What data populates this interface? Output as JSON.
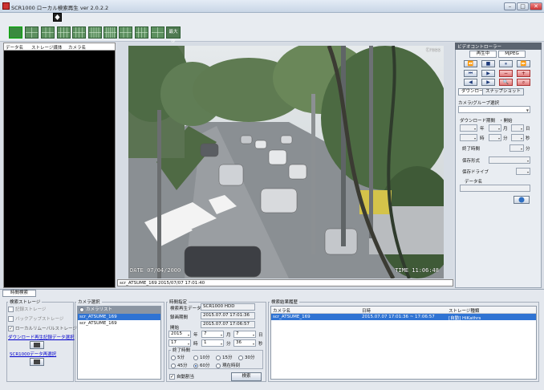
{
  "window": {
    "title": "SCR1000 ローカル検索再生  ver 2.0.2.2"
  },
  "left_list": {
    "headers": [
      "データ名",
      "ストレージ媒体",
      "カメラ名"
    ]
  },
  "video": {
    "caption_name": "scr_ATSUME_169",
    "caption_time": "2015/07/07 17:01:40",
    "osd_brand": "Cross",
    "osd_date": "DATE 07/04/2000",
    "osd_time": "TIME 11:06:48"
  },
  "video_controller": {
    "title": "ビデオコントローラー",
    "mode_tabs": [
      "再生中",
      "MJPEG"
    ],
    "tabs": [
      "ダウンロード",
      "スナップショット"
    ],
    "camera_group_label": "カメラ/グループ選択",
    "download_period_label": "ダウンロード期間",
    "start_label": "・開始",
    "year_unit": "年",
    "month_unit": "月",
    "day_unit": "日",
    "hour_unit": "時",
    "minute_unit": "分",
    "second_unit": "秒",
    "end_time_label": "終了時間",
    "end_minute_unit": "分",
    "save_format_label": "保存形式",
    "save_drive_label": "保存ドライブ",
    "data_name_label": "データ名"
  },
  "bottom_tab": "時間検索",
  "search_storage": {
    "title": "検索ストレージ",
    "options": [
      "記録ストレージ",
      "バックアップストレージ",
      "ローカルリムーバルストレージ"
    ],
    "download_link": "ダウンロード再生記録データ選択",
    "scr_link": "SCR1000データ再選択"
  },
  "camera_select": {
    "title": "カメラ選択",
    "items": [
      "カメラリスト",
      "scr_ATSUME_169",
      "scr_ATSUME_169"
    ]
  },
  "time_spec": {
    "title": "時間指定",
    "search_data_label": "検索再生データ",
    "search_data_value": "SCR1000 HDD",
    "recording_period_label": "録画期間",
    "recording_start": "2015.07.07 17:01:36",
    "recording_end": "2015.07.07 17:06:57",
    "start_label": "開始",
    "year": "2015",
    "year_unit": "年",
    "month": "7",
    "month_unit": "月",
    "day": "7",
    "day_unit": "日",
    "hour": "17",
    "hour_unit": "時",
    "minute": "1",
    "minute_unit": "分",
    "second": "36",
    "second_unit": "秒",
    "end_time_label": "終了時間",
    "durations": [
      "5分",
      "10分",
      "15分",
      "30分",
      "45分",
      "60分",
      "現在時刻"
    ],
    "selected_duration": "60分",
    "auto_split_label": "自動割当",
    "search_button": "検索"
  },
  "results": {
    "title": "検索結果履歴",
    "headers": [
      "カメラ名",
      "日時",
      "ストレージ種類"
    ],
    "rows": [
      {
        "camera": "scr_ATSUME_169",
        "datetime": "2015.07.07 17:01:36 ~ 17:06:57",
        "storage": "[自動] HiKathrs"
      }
    ]
  }
}
